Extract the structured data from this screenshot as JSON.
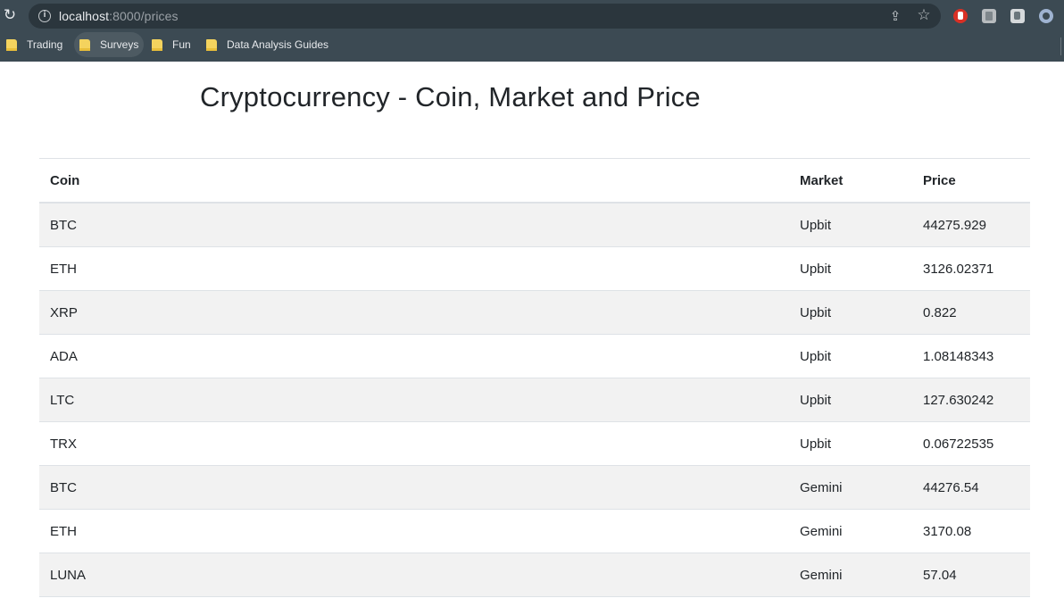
{
  "browser": {
    "url_host": "localhost",
    "url_path": ":8000/prices",
    "bookmarks": [
      {
        "label": "Trading"
      },
      {
        "label": "Surveys"
      },
      {
        "label": "Fun"
      },
      {
        "label": "Data Analysis Guides"
      }
    ],
    "icons": [
      "reload-icon",
      "info-icon",
      "share-icon",
      "star-icon",
      "extension-icon",
      "folder-icon"
    ]
  },
  "page": {
    "title": "Cryptocurrency - Coin, Market and Price",
    "table": {
      "headers": {
        "coin": "Coin",
        "market": "Market",
        "price": "Price"
      },
      "rows": [
        {
          "coin": "BTC",
          "market": "Upbit",
          "price": "44275.929"
        },
        {
          "coin": "ETH",
          "market": "Upbit",
          "price": "3126.02371"
        },
        {
          "coin": "XRP",
          "market": "Upbit",
          "price": "0.822"
        },
        {
          "coin": "ADA",
          "market": "Upbit",
          "price": "1.08148343"
        },
        {
          "coin": "LTC",
          "market": "Upbit",
          "price": "127.630242"
        },
        {
          "coin": "TRX",
          "market": "Upbit",
          "price": "0.06722535"
        },
        {
          "coin": "BTC",
          "market": "Gemini",
          "price": "44276.54"
        },
        {
          "coin": "ETH",
          "market": "Gemini",
          "price": "3170.08"
        },
        {
          "coin": "LUNA",
          "market": "Gemini",
          "price": "57.04"
        }
      ]
    }
  }
}
